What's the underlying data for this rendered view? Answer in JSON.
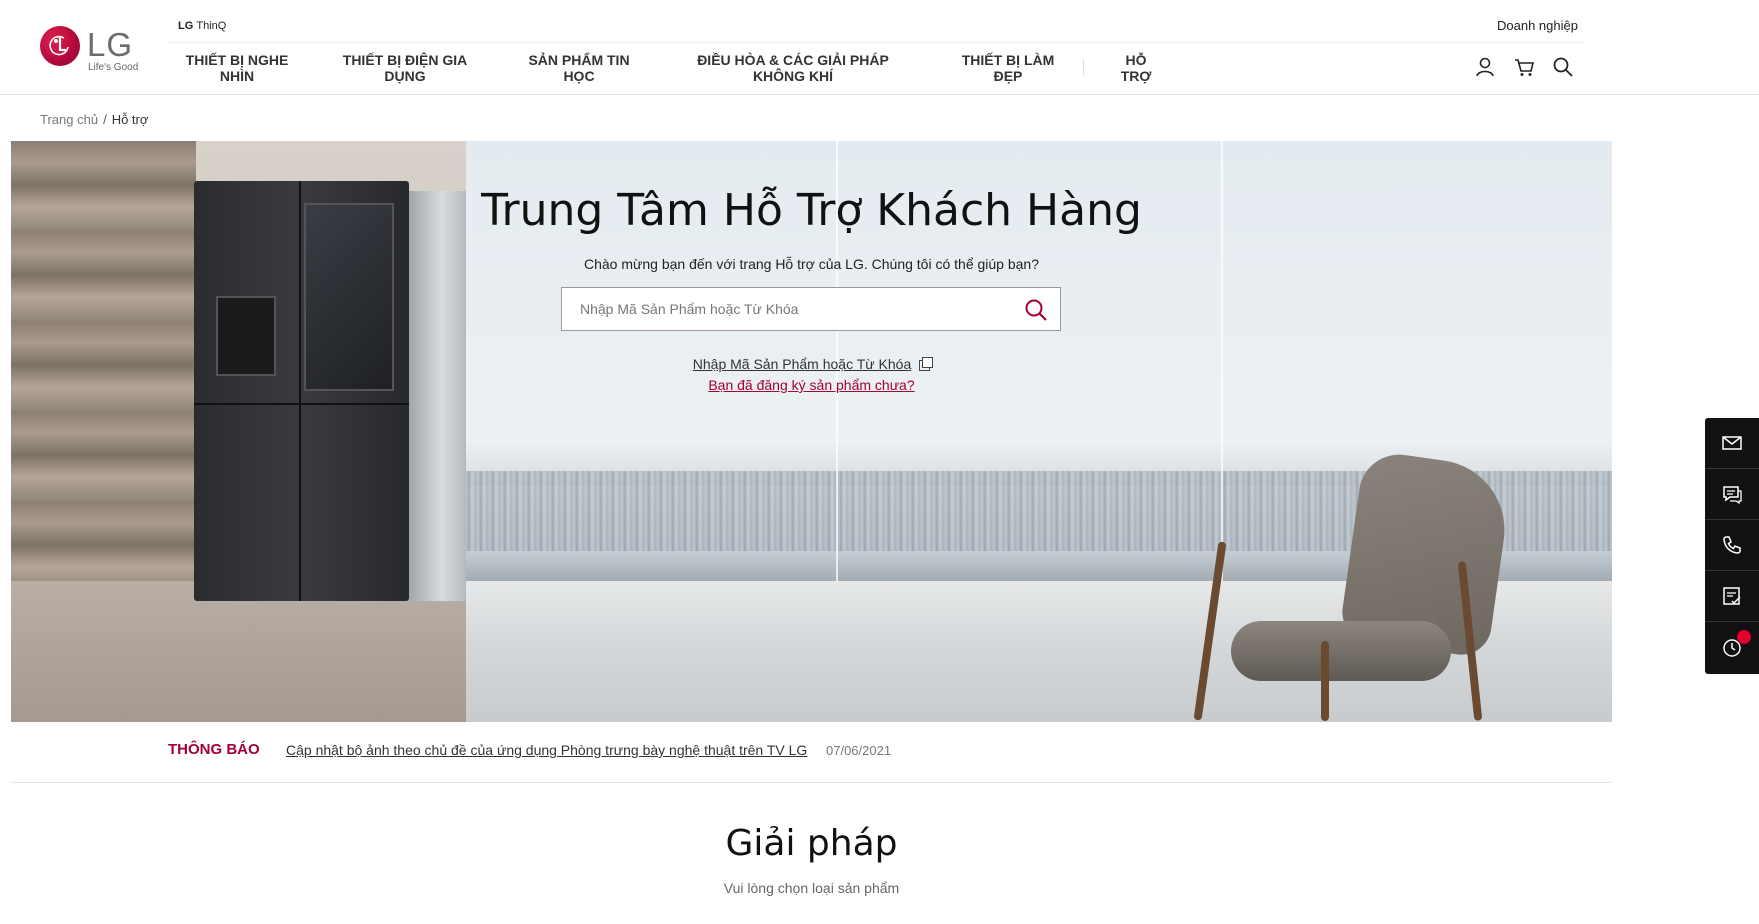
{
  "header": {
    "logo_text": "LG",
    "logo_sub": "Life's Good",
    "thinq_brand": "LG",
    "thinq_label": "ThinQ",
    "business_link": "Doanh nghiệp",
    "nav": [
      {
        "label": "THIẾT BỊ NGHE NHÌN"
      },
      {
        "label": "THIẾT BỊ ĐIỆN GIA DỤNG"
      },
      {
        "label": "SẢN PHẨM TIN HỌC"
      },
      {
        "label": "ĐIỀU HÒA & CÁC GIẢI PHÁP KHÔNG KHÍ"
      },
      {
        "label": "THIẾT BỊ LÀM ĐẸP"
      },
      {
        "label": "HỖ TRỢ"
      }
    ],
    "icons": [
      "user-icon",
      "cart-icon",
      "search-icon"
    ]
  },
  "breadcrumb": {
    "home": "Trang chủ",
    "separator": "/",
    "current": "Hỗ trợ"
  },
  "hero": {
    "title": "Trung Tâm Hỗ Trợ Khách Hàng",
    "subtitle": "Chào mừng bạn đến với trang Hỗ trợ của LG. Chúng tôi có thể giúp bạn?",
    "search_placeholder": "Nhập Mã Sản Phẩm hoặc Từ Khóa",
    "link_find_model": "Nhập Mã Sản Phẩm hoặc Từ Khóa",
    "link_register": "Bạn đã đăng ký sản phẩm chưa?"
  },
  "notice": {
    "label": "THÔNG BÁO",
    "text": "Cập nhật bộ ảnh theo chủ đề của ứng dụng Phòng trưng bày nghệ thuật trên TV LG",
    "date": "07/06/2021"
  },
  "solutions": {
    "title": "Giải pháp",
    "subtitle": "Vui lòng chọn loại sản phẩm"
  },
  "side_bar": {
    "items": [
      "email-icon",
      "chat-icon",
      "phone-icon",
      "checklist-icon",
      "history-icon"
    ]
  },
  "colors": {
    "brand": "#a50034",
    "text": "#333333",
    "sidebar_bg": "#111111",
    "notification_dot": "#e0002a"
  }
}
